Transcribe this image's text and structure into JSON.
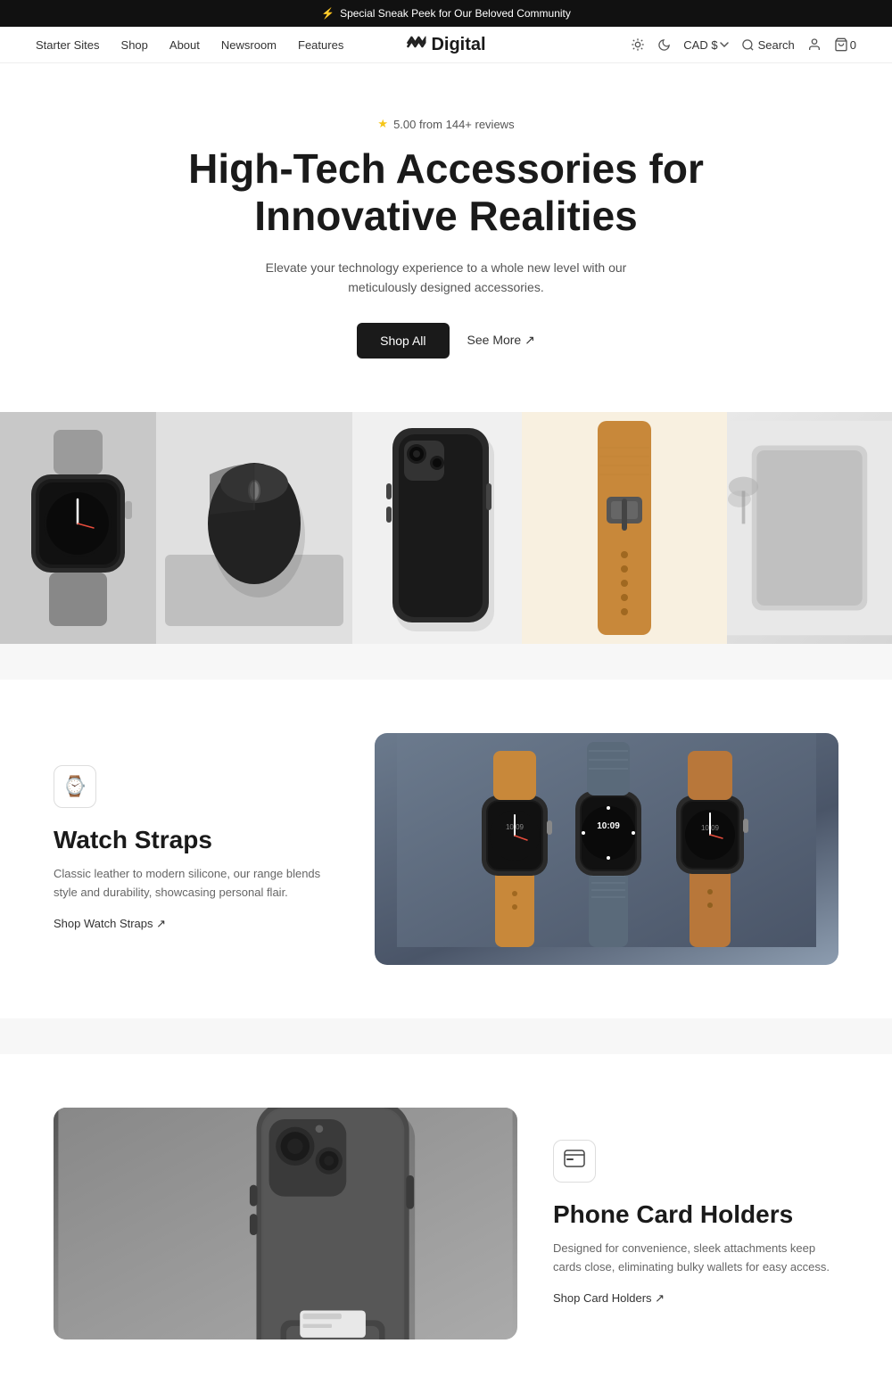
{
  "announcement": {
    "icon": "⚡",
    "text": "Special Sneak Peek for Our Beloved Community"
  },
  "header": {
    "nav_items": [
      {
        "label": "Starter Sites",
        "href": "#"
      },
      {
        "label": "Shop",
        "href": "#"
      },
      {
        "label": "About",
        "href": "#"
      },
      {
        "label": "Newsroom",
        "href": "#"
      },
      {
        "label": "Features",
        "href": "#"
      }
    ],
    "logo_text": "Digital",
    "currency": "CAD $",
    "search_label": "Search",
    "cart_count": "0"
  },
  "hero": {
    "rating_text": "5.00 from 144+ reviews",
    "headline_line1": "High-Tech Accessories for",
    "headline_line2": "Innovative Realities",
    "subtext": "Elevate your technology experience to a whole new level with our meticulously designed accessories.",
    "cta_primary": "Shop All",
    "cta_secondary": "See More ↗"
  },
  "watch_straps": {
    "icon": "⌚",
    "title": "Watch Straps",
    "description": "Classic leather to modern silicone, our range blends style and durability, showcasing personal flair.",
    "shop_link": "Shop Watch Straps ↗"
  },
  "phone_card_holders": {
    "icon": "🪪",
    "title": "Phone Card Holders",
    "description": "Designed for convenience, sleek attachments keep cards close, eliminating bulky wallets for easy access.",
    "shop_link": "Shop Card Holders ↗"
  }
}
